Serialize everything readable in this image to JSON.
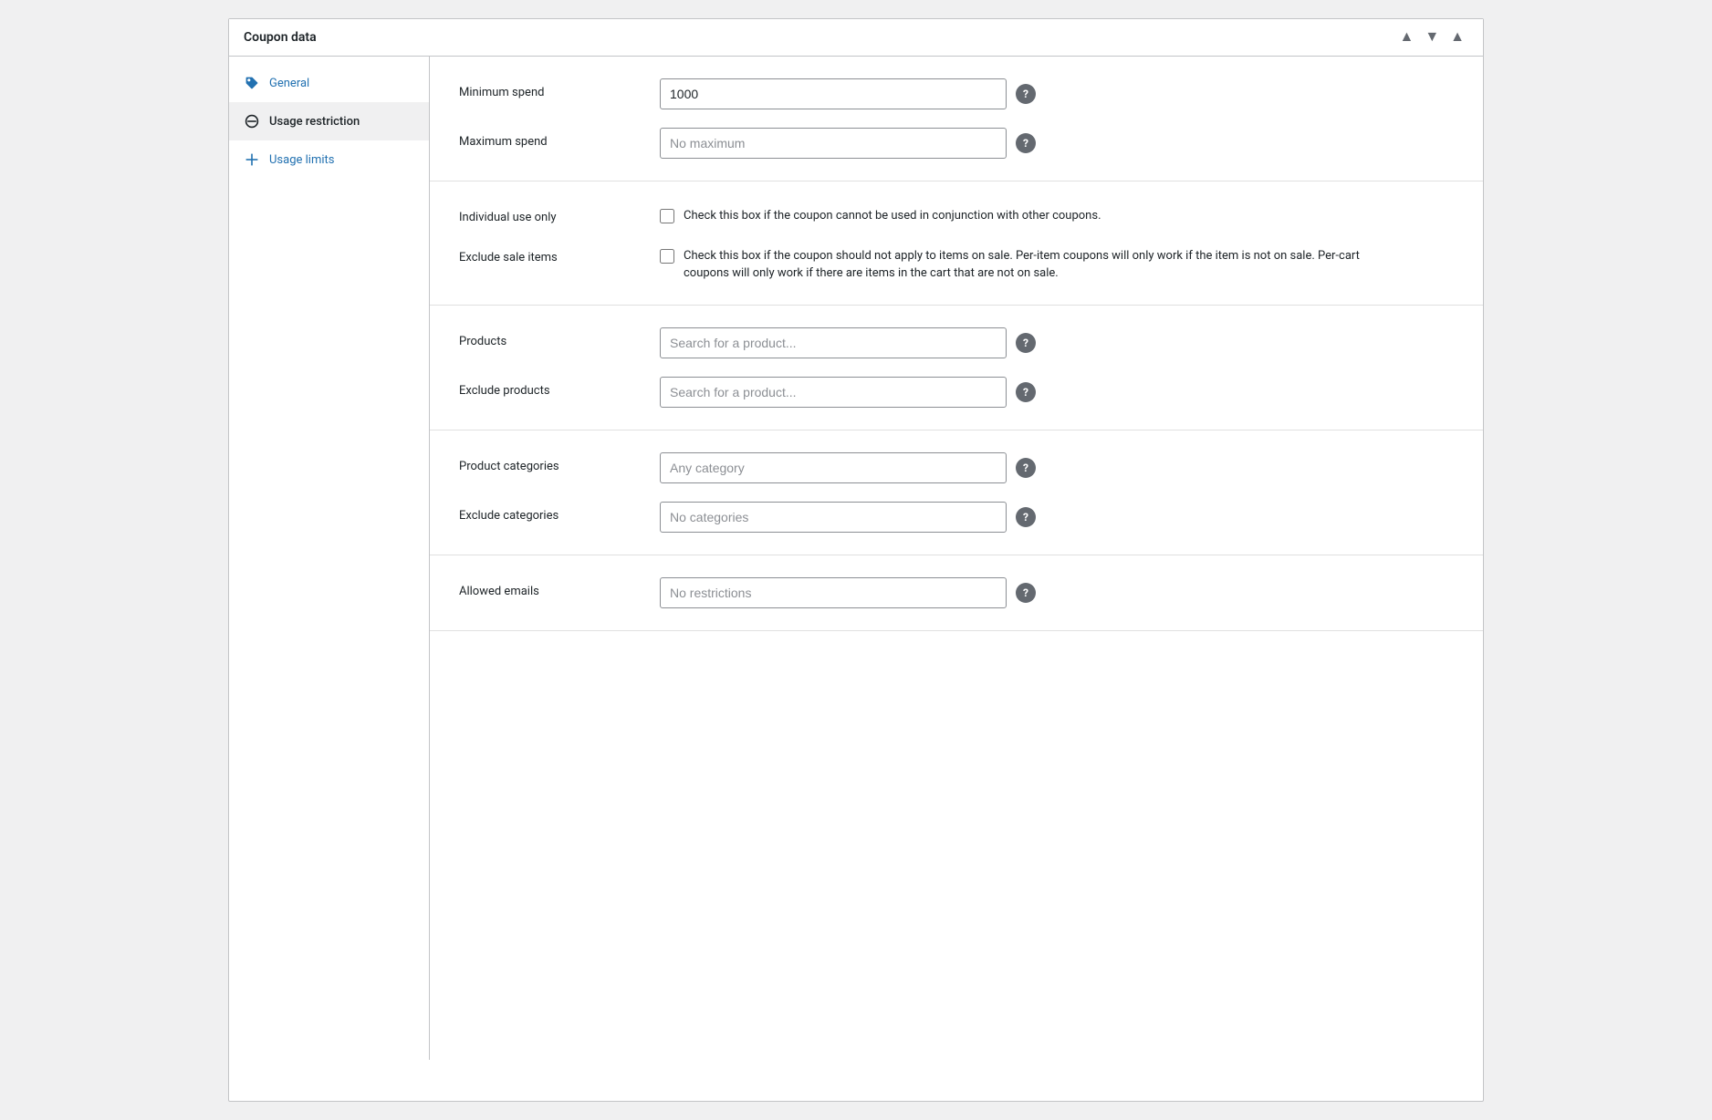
{
  "panel": {
    "title": "Coupon data"
  },
  "header": {
    "collapse_label": "▲",
    "up_label": "▲",
    "down_label": "▼"
  },
  "sidebar": {
    "items": [
      {
        "id": "general",
        "label": "General",
        "icon": "tag-icon",
        "active": false,
        "blue": true
      },
      {
        "id": "usage-restriction",
        "label": "Usage restriction",
        "icon": "ban-icon",
        "active": true,
        "blue": false
      },
      {
        "id": "usage-limits",
        "label": "Usage limits",
        "icon": "plus-icon",
        "active": false,
        "blue": true
      }
    ]
  },
  "form": {
    "sections": [
      {
        "id": "spend-section",
        "rows": [
          {
            "id": "minimum-spend",
            "label": "Minimum spend",
            "type": "input",
            "value": "1000",
            "placeholder": ""
          },
          {
            "id": "maximum-spend",
            "label": "Maximum spend",
            "type": "input",
            "value": "",
            "placeholder": "No maximum"
          }
        ]
      },
      {
        "id": "use-section",
        "rows": [
          {
            "id": "individual-use",
            "label": "Individual use only",
            "type": "checkbox",
            "checked": false,
            "description": "Check this box if the coupon cannot be used in conjunction with other coupons."
          },
          {
            "id": "exclude-sale",
            "label": "Exclude sale items",
            "type": "checkbox",
            "checked": false,
            "description": "Check this box if the coupon should not apply to items on sale. Per-item coupons will only work if the item is not on sale. Per-cart coupons will only work if there are items in the cart that are not on sale."
          }
        ]
      },
      {
        "id": "products-section",
        "rows": [
          {
            "id": "products",
            "label": "Products",
            "type": "input",
            "value": "",
            "placeholder": "Search for a product..."
          },
          {
            "id": "exclude-products",
            "label": "Exclude products",
            "type": "input",
            "value": "",
            "placeholder": "Search for a product..."
          }
        ]
      },
      {
        "id": "categories-section",
        "rows": [
          {
            "id": "product-categories",
            "label": "Product categories",
            "type": "input",
            "value": "",
            "placeholder": "Any category"
          },
          {
            "id": "exclude-categories",
            "label": "Exclude categories",
            "type": "input",
            "value": "",
            "placeholder": "No categories"
          }
        ]
      },
      {
        "id": "emails-section",
        "rows": [
          {
            "id": "allowed-emails",
            "label": "Allowed emails",
            "type": "input",
            "value": "",
            "placeholder": "No restrictions"
          }
        ]
      }
    ]
  }
}
